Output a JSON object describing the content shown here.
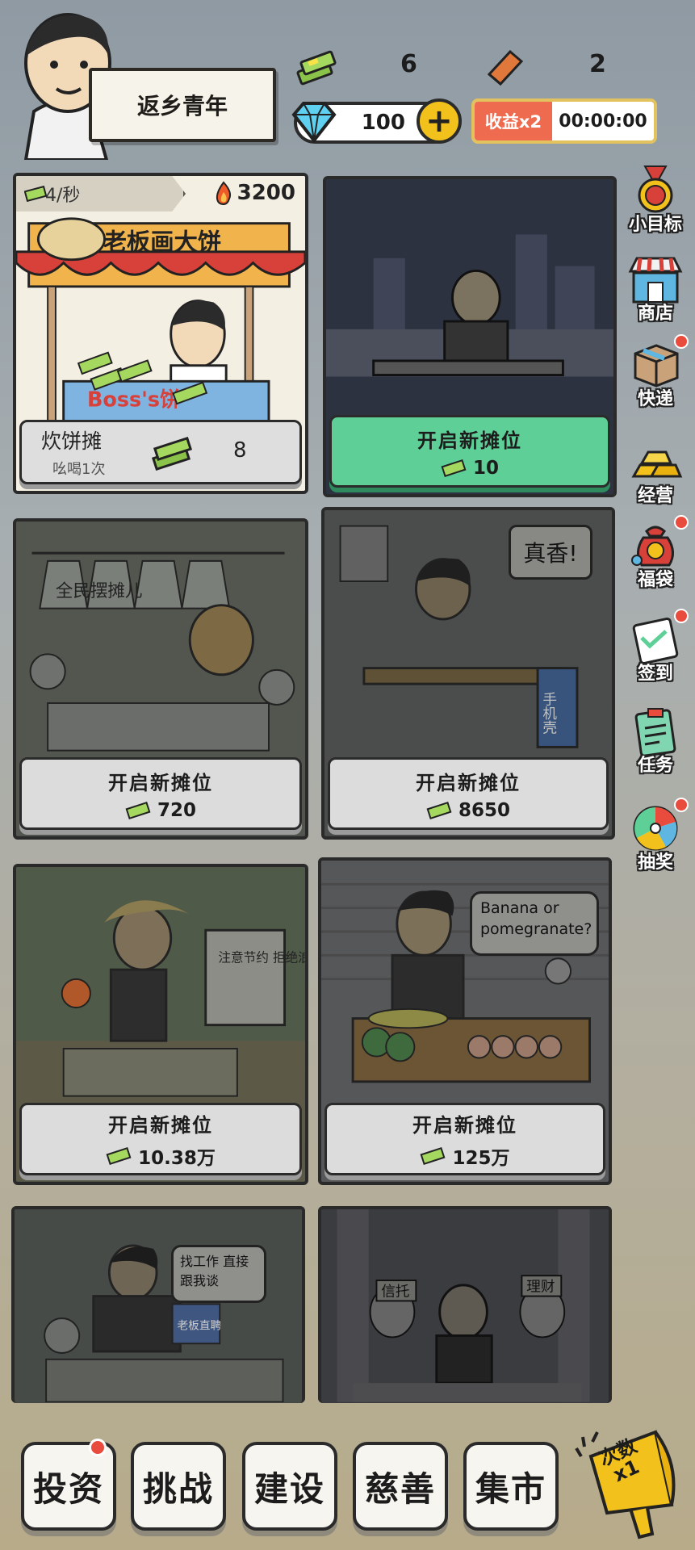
{
  "player": {
    "title": "返乡青年"
  },
  "resources": {
    "cash": "6",
    "bricks": "2",
    "diamonds": "100"
  },
  "boost": {
    "label": "收益x2",
    "timer": "00:00:00"
  },
  "active_stall": {
    "rate": "4/秒",
    "fire": "3200",
    "name": "炊饼摊",
    "sub": "吆喝1次",
    "count": "8",
    "sign": "老板画大饼",
    "shop_sign": "Boss's饼"
  },
  "locked_stalls": [
    {
      "title": "开启新摊位",
      "price": "10",
      "style": "green"
    },
    {
      "title": "开启新摊位",
      "price": "720",
      "scene_text": "全民摆摊儿"
    },
    {
      "title": "开启新摊位",
      "price": "8650",
      "bubble": "真香!",
      "sign": "手机壳"
    },
    {
      "title": "开启新摊位",
      "price": "10.38万",
      "sign": "注意节约 拒绝浪费"
    },
    {
      "title": "开启新摊位",
      "price": "125万",
      "bubble": "Banana or pomegranate?"
    }
  ],
  "preview_stalls": [
    {
      "bubble": "找工作 直接跟我谈",
      "sign": "老板直聘"
    },
    {
      "signs": [
        "信托",
        "理财"
      ]
    }
  ],
  "sidebar": [
    {
      "label": "小目标",
      "icon": "medal-icon",
      "dot": false
    },
    {
      "label": "商店",
      "icon": "shop-icon",
      "dot": false
    },
    {
      "label": "快递",
      "icon": "package-icon",
      "dot": true
    },
    {
      "label": "经营",
      "icon": "gold-bars-icon",
      "dot": false
    },
    {
      "label": "福袋",
      "icon": "lucky-bag-icon",
      "dot": true
    },
    {
      "label": "签到",
      "icon": "calendar-icon",
      "dot": true
    },
    {
      "label": "任务",
      "icon": "clipboard-icon",
      "dot": false
    },
    {
      "label": "抽奖",
      "icon": "wheel-icon",
      "dot": true
    }
  ],
  "nav": [
    {
      "label": "投资",
      "dot": true
    },
    {
      "label": "挑战",
      "dot": false
    },
    {
      "label": "建设",
      "dot": false
    },
    {
      "label": "慈善",
      "dot": false
    },
    {
      "label": "集市",
      "dot": false
    }
  ],
  "megaphone": {
    "line1": "次数",
    "line2": "x1"
  },
  "colors": {
    "green_button": "#5ecf96",
    "boost_red": "#ef6b4f",
    "gold": "#f3c11c"
  }
}
